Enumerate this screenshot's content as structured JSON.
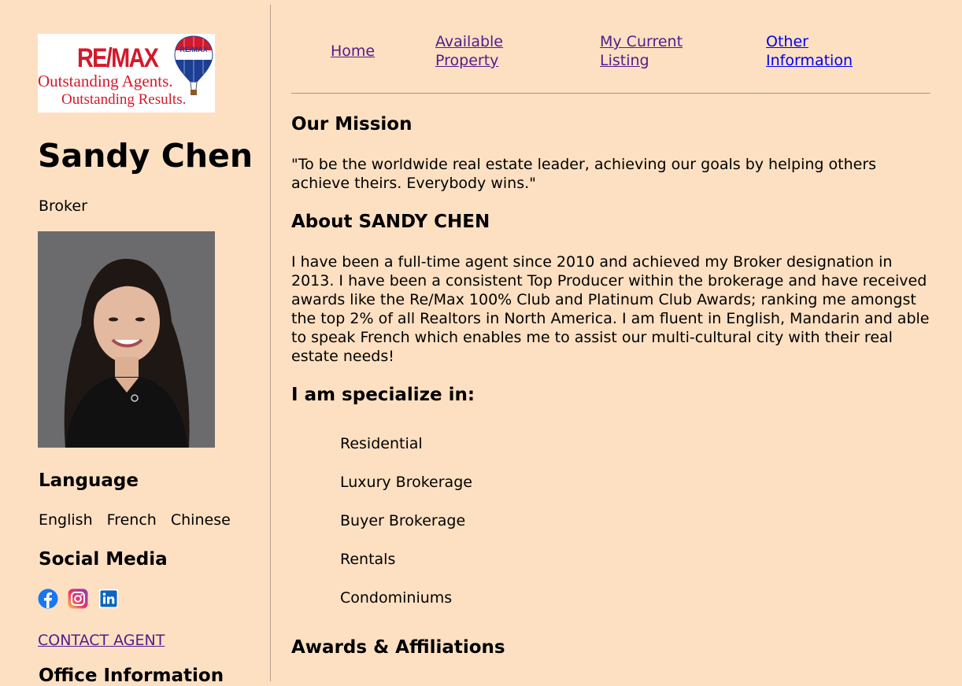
{
  "logo": {
    "brand": "RE/MAX",
    "balloon_text": "RE/MAX",
    "line1": "Outstanding Agents.",
    "line2": "Outstanding Results.",
    "colors": {
      "red": "#d5182a",
      "blue": "#1c3f94"
    }
  },
  "agent": {
    "name": "Sandy Chen",
    "title": "Broker"
  },
  "sidebar": {
    "language_heading": "Language",
    "languages": [
      "English",
      "French",
      "Chinese"
    ],
    "social_heading": "Social Media",
    "social_icons": [
      "facebook-icon",
      "instagram-icon",
      "linkedin-icon"
    ],
    "contact_link": "CONTACT AGENT",
    "office_heading": "Office Information"
  },
  "nav": {
    "home": "Home",
    "available_property_line1": "Available",
    "available_property_line2": "Property",
    "current_listing_line1": "My Current",
    "current_listing_line2": "Listing",
    "other_info_line1": "Other",
    "other_info_line2": "Information"
  },
  "main": {
    "mission_heading": "Our Mission",
    "mission_text": "\"To be the worldwide real estate leader, achieving our goals by helping others achieve theirs. Everybody wins.\"",
    "about_heading": "About SANDY CHEN",
    "about_text": "I have been a full-time agent since 2010 and achieved my Broker designation in 2013. I have been a consistent Top Producer within the brokerage and have received awards like the Re/Max 100% Club and Platinum Club Awards; ranking me amongst the top 2% of all Realtors in North America. I am fluent in English, Mandarin and able to speak French which enables me to assist our multi-cultural city with their real estate needs!",
    "specialize_heading": "I am specialize in:",
    "specialties": [
      "Residential",
      "Luxury Brokerage",
      "Buyer Brokerage",
      "Rentals",
      "Condominiums"
    ],
    "awards_heading": "Awards & Affiliations"
  },
  "colors": {
    "page_background": "#fde0c2",
    "link_visited": "#551a8b",
    "link_unvisited": "#0000ee"
  }
}
